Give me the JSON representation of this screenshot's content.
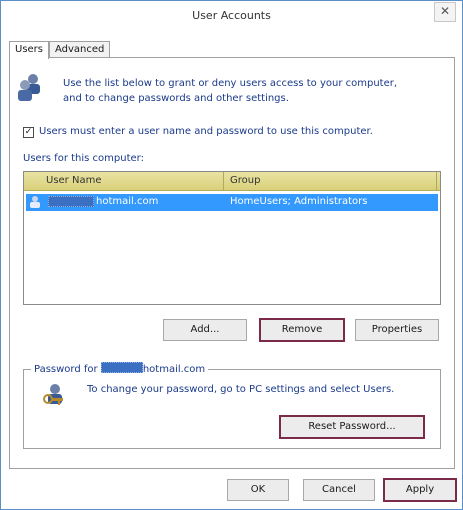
{
  "window": {
    "title": "User Accounts",
    "close_glyph": "✕"
  },
  "tabs": [
    {
      "label": "Users",
      "active": true
    },
    {
      "label": "Advanced",
      "active": false
    }
  ],
  "intro": {
    "line1": "Use the list below to grant or deny users access to your computer,",
    "line2": "and to change passwords and other settings."
  },
  "checkbox": {
    "label": "Users must enter a user name and password to use this computer.",
    "checked": true,
    "glyph": "✓"
  },
  "users_section": {
    "label": "Users for this computer:",
    "columns": [
      "User Name",
      "Group"
    ],
    "rows": [
      {
        "user_name": "hotmail.com",
        "group": "HomeUsers; Administrators"
      }
    ]
  },
  "user_buttons": {
    "add": "Add...",
    "remove": "Remove",
    "properties": "Properties"
  },
  "password_group": {
    "title_prefix": "Password for",
    "title_suffix": "hotmail.com",
    "text": "To change your password, go to PC settings and select Users.",
    "reset_button": "Reset Password..."
  },
  "dialog_buttons": {
    "ok": "OK",
    "cancel": "Cancel",
    "apply": "Apply"
  },
  "colors": {
    "accent": "#3399ff",
    "focus_border": "#7a2b4a",
    "header": "#e0d98f"
  }
}
